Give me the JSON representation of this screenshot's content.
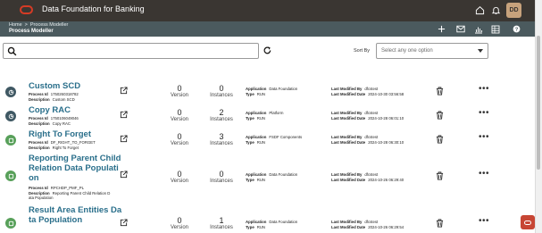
{
  "header": {
    "app_title": "Data Foundation for Banking",
    "avatar_initials": "DD",
    "icons": [
      "home-icon",
      "bell-icon"
    ]
  },
  "subheader": {
    "breadcrumb": [
      "Home",
      "Process Modeller"
    ],
    "breadcrumb_separator": ">",
    "page_title": "Process Modeller",
    "icons": [
      "add-icon",
      "mail-icon",
      "chart-icon",
      "grid-icon",
      "monitor-icon",
      "help-icon"
    ]
  },
  "search": {
    "placeholder": ""
  },
  "sort": {
    "label": "Sort By",
    "placeholder": "Select any one option"
  },
  "labels": {
    "process_id": "Process Id",
    "description": "Description",
    "version": "Version",
    "instances": "Instances",
    "application": "Application",
    "type": "Type",
    "last_modified_by": "Last Modified By",
    "last_modified_date": "Last Modified Date"
  },
  "processes": [
    {
      "name": "Custom SCD",
      "process_id": "1750260318782",
      "description": "Custom SCD",
      "version": "0",
      "instances": "0",
      "application": "Data Foundation",
      "type": "RUN",
      "last_modified_by": "dfcstest",
      "last_modified_date": "2024-10-30 03:56:58",
      "status": "blue"
    },
    {
      "name": "Copy RAC",
      "process_id": "1750106049046",
      "description": "Copy RAC",
      "version": "0",
      "instances": "2",
      "application": "Platform",
      "type": "RUN",
      "last_modified_by": "dfcstest",
      "last_modified_date": "2024-10-28 06:01:10",
      "status": "blue"
    },
    {
      "name": "Right To Forget",
      "process_id": "DF_RIGHT_TO_FORGET",
      "description": "Right To Forget",
      "version": "0",
      "instances": "3",
      "application": "FSDF Components",
      "type": "RUN",
      "last_modified_by": "dfcstest",
      "last_modified_date": "2024-10-28 06:30:10",
      "status": "green"
    },
    {
      "name_lines": [
        "Reporting Parent Child",
        "Relation Data Populati",
        "on"
      ],
      "process_id": "RPCHDP_PMF_PL",
      "description_lines": [
        "Reporting Parent Child Relation D",
        "ata Population"
      ],
      "version": "0",
      "instances": "0",
      "application": "Data Foundation",
      "type": "RUN",
      "last_modified_by": "dfcstest",
      "last_modified_date": "2024-10-26 06:29:40",
      "status": "green"
    },
    {
      "name_lines": [
        "Result Area Entities Da",
        "ta Population"
      ],
      "version": "0",
      "instances": "1",
      "application": "Data Foundation",
      "type": "RUN",
      "last_modified_by": "dfcstest",
      "last_modified_date": "2024-10-26 06:29:54",
      "status": "green"
    }
  ],
  "colors": {
    "topbar": "#3a3632",
    "subbar": "#4b5a5e",
    "link": "#2a6f8b",
    "oracle_red": "#c74634"
  }
}
